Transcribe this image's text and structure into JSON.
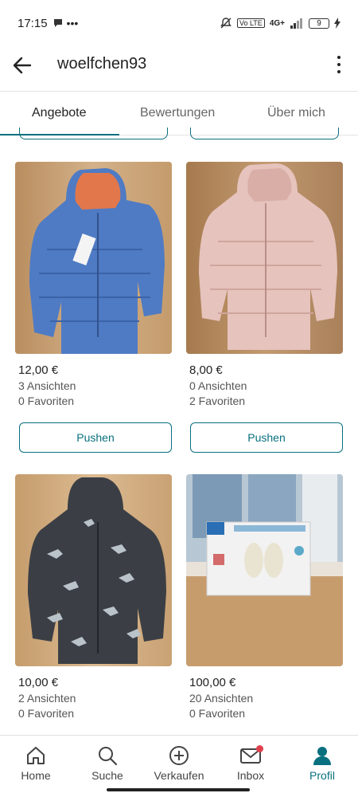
{
  "status": {
    "time": "17:15",
    "network": "4G+",
    "battery": "9"
  },
  "header": {
    "title": "woelfchen93"
  },
  "tabs": [
    {
      "label": "Angebote"
    },
    {
      "label": "Bewertungen"
    },
    {
      "label": "Über mich"
    }
  ],
  "items": [
    {
      "price": "12,00 €",
      "views": "3 Ansichten",
      "favorites": "0 Favoriten",
      "action": "Pushen",
      "image": "blue puffer jacket with orange hood"
    },
    {
      "price": "8,00 €",
      "views": "0 Ansichten",
      "favorites": "2 Favoriten",
      "action": "Pushen",
      "image": "pink puffer jacket"
    },
    {
      "price": "10,00 €",
      "views": "2 Ansichten",
      "favorites": "0 Favoriten",
      "image": "dark grey dinosaur print puffer jacket"
    },
    {
      "price": "100,00 €",
      "views": "20 Ansichten",
      "favorites": "0 Favoriten",
      "image": "MAM double electric breast pump box"
    }
  ],
  "nav": [
    {
      "label": "Home",
      "icon": "home-icon"
    },
    {
      "label": "Suche",
      "icon": "search-icon"
    },
    {
      "label": "Verkaufen",
      "icon": "plus-circle-icon"
    },
    {
      "label": "Inbox",
      "icon": "mail-icon"
    },
    {
      "label": "Profil",
      "icon": "profile-icon"
    }
  ],
  "colors": {
    "accent": "#09707f",
    "notification": "#e0404b"
  }
}
